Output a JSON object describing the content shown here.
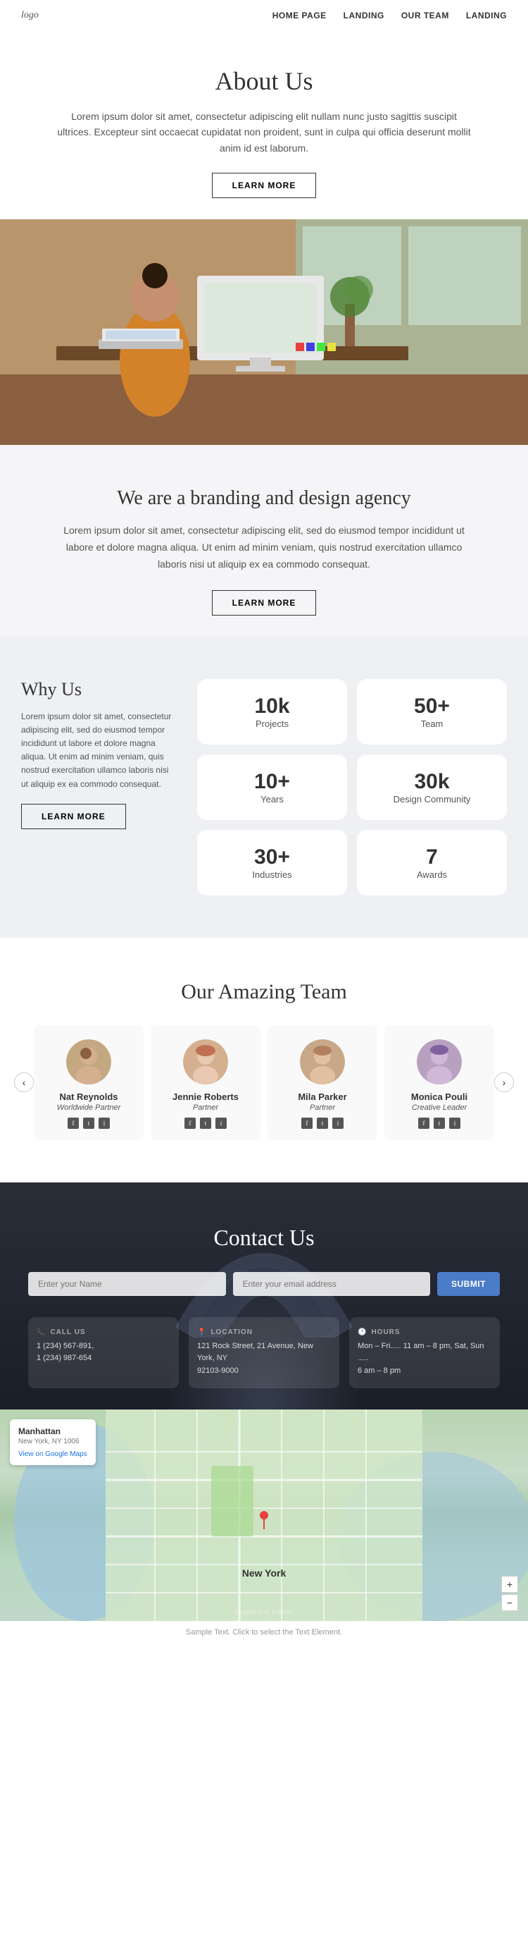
{
  "nav": {
    "logo": "logo",
    "links": [
      "HOME PAGE",
      "LANDING",
      "OUR TEAM",
      "LANDING"
    ]
  },
  "about": {
    "title": "About Us",
    "body": "Lorem ipsum dolor sit amet, consectetur adipiscing elit nullam nunc justo sagittis suscipit ultrices. Excepteur sint occaecat cupidatat non proident, sunt in culpa qui officia deserunt mollit anim id est laborum.",
    "btn": "LEARN MORE"
  },
  "branding": {
    "title": "We are a branding and design agency",
    "body": "Lorem ipsum dolor sit amet, consectetur adipiscing elit, sed do eiusmod tempor incididunt ut labore et dolore magna aliqua. Ut enim ad minim veniam, quis nostrud exercitation ullamco laboris nisi ut aliquip ex ea commodo consequat.",
    "btn": "LEARN MORE"
  },
  "whyUs": {
    "title": "Why Us",
    "body": "Lorem ipsum dolor sit amet, consectetur adipiscing elit, sed do eiusmod tempor incididunt ut labore et dolore magna aliqua. Ut enim ad minim veniam, quis nostrud exercitation ullamco laboris nisi ut aliquip ex ea commodo consequat.",
    "btn": "LEARN MORE",
    "stats": [
      {
        "num": "10k",
        "label": "Projects"
      },
      {
        "num": "50+",
        "label": "Team"
      },
      {
        "num": "10+",
        "label": "Years"
      },
      {
        "num": "30k",
        "label": "Design Community"
      },
      {
        "num": "30+",
        "label": "Industries"
      },
      {
        "num": "7",
        "label": "Awards"
      }
    ]
  },
  "team": {
    "title": "Our Amazing Team",
    "members": [
      {
        "name": "Nat Reynolds",
        "role": "Worldwide Partner",
        "bg": "#c4a882"
      },
      {
        "name": "Jennie Roberts",
        "role": "Partner",
        "bg": "#d4b090"
      },
      {
        "name": "Mila Parker",
        "role": "Partner",
        "bg": "#c8a888"
      },
      {
        "name": "Monica Pouli",
        "role": "Creative Leader",
        "bg": "#b8a0c0"
      }
    ]
  },
  "contact": {
    "title": "Contact Us",
    "form": {
      "namePlaceholder": "Enter your Name",
      "emailPlaceholder": "Enter your email address",
      "submitBtn": "SUBMIT"
    },
    "cards": [
      {
        "icon": "📞",
        "title": "CALL US",
        "lines": [
          "1 (234) 567-891,",
          "1 (234) 987-654"
        ]
      },
      {
        "icon": "📍",
        "title": "LOCATION",
        "lines": [
          "121 Rock Street, 21 Avenue, New York, NY",
          "92103-9000"
        ]
      },
      {
        "icon": "🕐",
        "title": "HOURS",
        "lines": [
          "Mon – Fri..... 11 am – 8 pm, Sat, Sun .....",
          "6 am – 8 pm"
        ]
      }
    ]
  },
  "map": {
    "label": "New York",
    "infoBox": {
      "title": "Manhattan",
      "sub": "New York, NY 1006",
      "link": "View on Google Maps"
    },
    "zoomIn": "+",
    "zoomOut": "−"
  },
  "footer": {
    "note": "Sample Text. Click to select the Text Element."
  }
}
